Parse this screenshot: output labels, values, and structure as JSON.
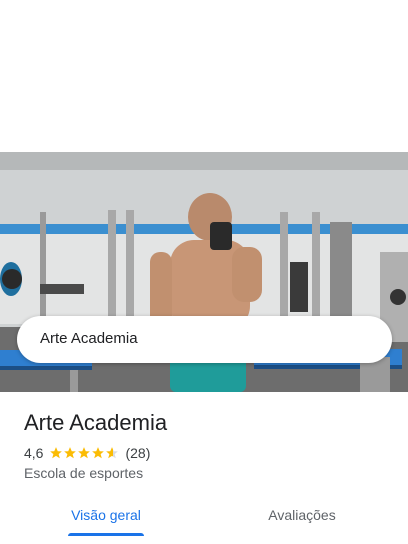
{
  "search": {
    "query": "Arte Academia"
  },
  "place": {
    "name": "Arte Academia",
    "rating": "4,6",
    "rating_stars": 4.6,
    "review_count": "(28)",
    "category": "Escola de esportes"
  },
  "tabs": [
    {
      "label": "Visão geral",
      "active": true
    },
    {
      "label": "Avaliações",
      "active": false
    }
  ],
  "colors": {
    "accent": "#1a73e8",
    "star": "#fbbc04",
    "text": "#202124"
  },
  "icons": {
    "search": "search-icon",
    "close": "close-icon",
    "star": "star-icon"
  }
}
